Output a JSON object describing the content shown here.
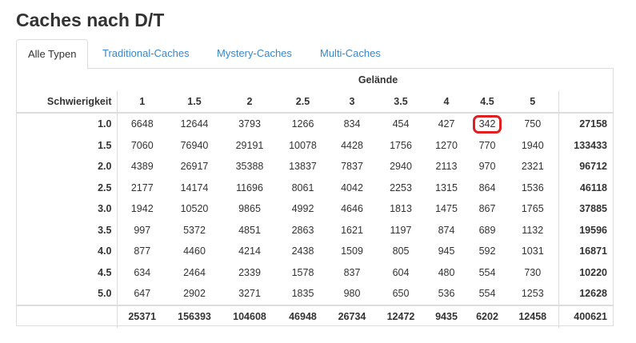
{
  "page": {
    "title": "Caches nach D/T"
  },
  "tabs": [
    {
      "label": "Alle Typen",
      "active": true
    },
    {
      "label": "Traditional-Caches",
      "active": false
    },
    {
      "label": "Mystery-Caches",
      "active": false
    },
    {
      "label": "Multi-Caches",
      "active": false
    }
  ],
  "table": {
    "terrain_header": "Gelände",
    "difficulty_header": "Schwierigkeit",
    "terrain_levels": [
      "1",
      "1.5",
      "2",
      "2.5",
      "3",
      "3.5",
      "4",
      "4.5",
      "5"
    ],
    "rows": [
      {
        "label": "1.0",
        "cells": [
          "6648",
          "12644",
          "3793",
          "1266",
          "834",
          "454",
          "427",
          "342",
          "750"
        ],
        "total": "27158"
      },
      {
        "label": "1.5",
        "cells": [
          "7060",
          "76940",
          "29191",
          "10078",
          "4428",
          "1756",
          "1270",
          "770",
          "1940"
        ],
        "total": "133433"
      },
      {
        "label": "2.0",
        "cells": [
          "4389",
          "26917",
          "35388",
          "13837",
          "7837",
          "2940",
          "2113",
          "970",
          "2321"
        ],
        "total": "96712"
      },
      {
        "label": "2.5",
        "cells": [
          "2177",
          "14174",
          "11696",
          "8061",
          "4042",
          "2253",
          "1315",
          "864",
          "1536"
        ],
        "total": "46118"
      },
      {
        "label": "3.0",
        "cells": [
          "1942",
          "10520",
          "9865",
          "4992",
          "4646",
          "1813",
          "1475",
          "867",
          "1765"
        ],
        "total": "37885"
      },
      {
        "label": "3.5",
        "cells": [
          "997",
          "5372",
          "4851",
          "2863",
          "1621",
          "1197",
          "874",
          "689",
          "1132"
        ],
        "total": "19596"
      },
      {
        "label": "4.0",
        "cells": [
          "877",
          "4460",
          "4214",
          "2438",
          "1509",
          "805",
          "945",
          "592",
          "1031"
        ],
        "total": "16871"
      },
      {
        "label": "4.5",
        "cells": [
          "634",
          "2464",
          "2339",
          "1578",
          "837",
          "604",
          "480",
          "554",
          "730"
        ],
        "total": "10220"
      },
      {
        "label": "5.0",
        "cells": [
          "647",
          "2902",
          "3271",
          "1835",
          "980",
          "650",
          "536",
          "554",
          "1253"
        ],
        "total": "12628"
      }
    ],
    "column_totals": [
      "25371",
      "156393",
      "104608",
      "46948",
      "26734",
      "12472",
      "9435",
      "6202",
      "12458"
    ],
    "grand_total": "400621",
    "highlighted_cell": {
      "row": "1.0",
      "column": "4.5"
    },
    "highlight_color": "#e02020"
  },
  "colors": {
    "link": "#3a87c7",
    "border": "#dddddd",
    "text": "#333333"
  }
}
